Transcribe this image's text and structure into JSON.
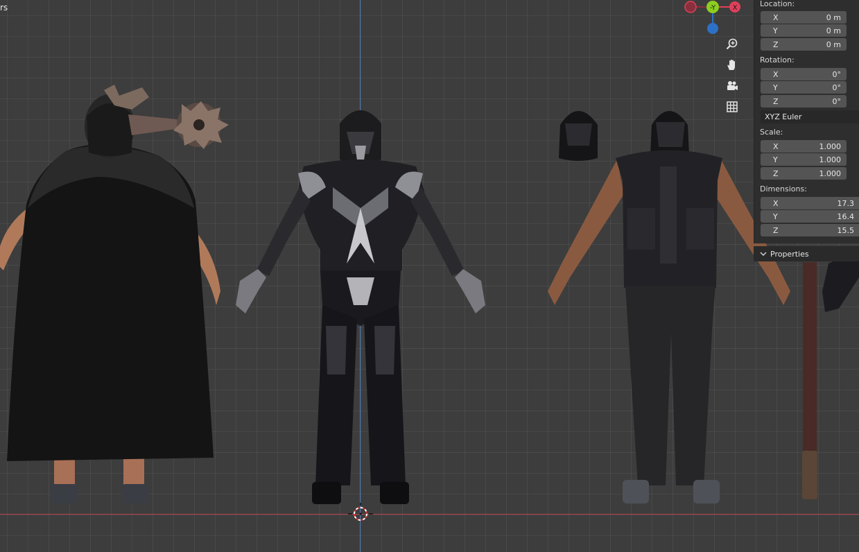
{
  "viewport": {
    "corner_text": "rs"
  },
  "gizmo": {
    "y_label": "-Y",
    "x_label": "X",
    "colors": {
      "x": "#e0405a",
      "x_neg": "#8a2f3c",
      "y": "#8ccf1e",
      "z": "#2d70c8"
    }
  },
  "nav_buttons": [
    "zoom-icon",
    "pan-hand-icon",
    "camera-icon",
    "grid-icon"
  ],
  "sidebar": {
    "location": {
      "label": "Location:",
      "x": {
        "axis": "X",
        "value": "0 m"
      },
      "y": {
        "axis": "Y",
        "value": "0 m"
      },
      "z": {
        "axis": "Z",
        "value": "0 m"
      }
    },
    "rotation": {
      "label": "Rotation:",
      "x": {
        "axis": "X",
        "value": "0°"
      },
      "y": {
        "axis": "Y",
        "value": "0°"
      },
      "z": {
        "axis": "Z",
        "value": "0°"
      },
      "mode": "XYZ Euler"
    },
    "scale": {
      "label": "Scale:",
      "x": {
        "axis": "X",
        "value": "1.000"
      },
      "y": {
        "axis": "Y",
        "value": "1.000"
      },
      "z": {
        "axis": "Z",
        "value": "1.000"
      }
    },
    "dimensions": {
      "label": "Dimensions:",
      "x": {
        "axis": "X",
        "value": "17.3"
      },
      "y": {
        "axis": "Y",
        "value": "16.4"
      },
      "z": {
        "axis": "Z",
        "value": "15.5"
      }
    },
    "properties_label": "Properties"
  }
}
